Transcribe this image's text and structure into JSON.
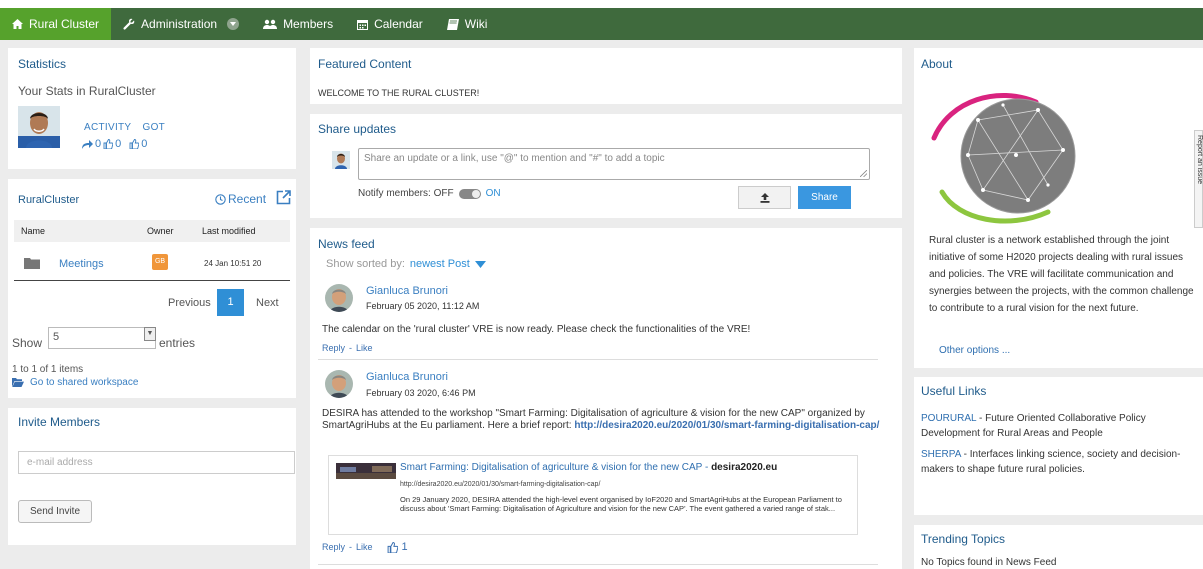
{
  "nav": {
    "home_label": "Rural Cluster",
    "admin_label": "Administration",
    "members_label": "Members",
    "calendar_label": "Calendar",
    "wiki_label": "Wiki"
  },
  "statistics": {
    "title": "Statistics",
    "subtitle": "Your Stats in RuralCluster",
    "activity_label": "ACTIVITY",
    "got_label": "GOT",
    "shares": "0",
    "likes": "0",
    "likes_got": "0"
  },
  "workspace": {
    "title": "RuralCluster",
    "recent_label": "Recent",
    "col_name": "Name",
    "col_owner": "Owner",
    "col_modified": "Last modified",
    "rows": [
      {
        "name": "Meetings",
        "owner_initials": "GB",
        "modified": "24 Jan 10:51 20"
      }
    ],
    "pager_prev": "Previous",
    "pager_current": "1",
    "pager_next": "Next",
    "show_label": "Show",
    "show_value": "5",
    "entries_label": "entries",
    "info": "1 to 1 of 1 items",
    "goto_label": "Go to shared workspace"
  },
  "invite": {
    "title": "Invite Members",
    "email_placeholder": "e-mail address",
    "send_label": "Send Invite"
  },
  "featured": {
    "title": "Featured Content",
    "text": "WELCOME TO THE RURAL CLUSTER!"
  },
  "share": {
    "title": "Share updates",
    "placeholder": "Share an update or a link, use \"@\" to mention and \"#\" to add a topic",
    "notify_label": "Notify members: OFF",
    "notify_on": "ON",
    "share_label": "Share"
  },
  "feed": {
    "title": "News feed",
    "sort_label": "Show sorted by:",
    "sort_value": "newest Post",
    "posts": [
      {
        "author": "Gianluca Brunori",
        "date": "February 05 2020, 11:12 AM",
        "body": "The calendar on the 'rural cluster' VRE is now ready. Please check the functionalities of the VRE!",
        "reply": "Reply",
        "like": "Like"
      },
      {
        "author": "Gianluca Brunori",
        "date": "February 03 2020, 6:46 PM",
        "body": "DESIRA has attended to the workshop \"Smart Farming: Digitalisation of agriculture & vision for the new CAP\" organized by SmartAgriHubs at the Eu parliament. Here a brief report: ",
        "link": "http://desira2020.eu/2020/01/30/smart-farming-digitalisation-cap/",
        "preview_title": "Smart Farming: Digitalisation of agriculture & vision for the new CAP",
        "preview_site": "desira2020.eu",
        "preview_url": "http://desira2020.eu/2020/01/30/smart-farming-digitalisation-cap/",
        "preview_desc": "On 29 January 2020, DESIRA attended the high-level event organised by IoF2020 and SmartAgriHubs at the European Parliament to discuss about 'Smart Farming: Digitalisation of Agriculture and vision for the new CAP'. The event gathered a varied range of stak...",
        "reply": "Reply",
        "like": "Like",
        "like_count": "1"
      }
    ]
  },
  "about": {
    "title": "About",
    "text": "Rural cluster is a network established through the joint initiative of some H2020 projects dealing with rural issues and policies. The VRE will facilitate communication and synergies between the projects, with the common challenge to contribute to a rural vision for the next future.",
    "more": "Other options ...",
    "report_tab": "Report an issue"
  },
  "useful_links": {
    "title": "Useful Links",
    "items": [
      {
        "link": "POURURAL",
        "text": " - Future Oriented Collaborative Policy Development for Rural Areas and People"
      },
      {
        "link": "SHERPA",
        "text": " - Interfaces linking science, society and decision-makers to shape future rural policies."
      }
    ]
  },
  "trending": {
    "title": "Trending Topics",
    "text": "No Topics found in News Feed"
  },
  "colors": {
    "nav_bg": "#3f6a3d",
    "nav_active": "#56a22c",
    "link": "#2f6fb0",
    "primary_button": "#3a97e0"
  }
}
